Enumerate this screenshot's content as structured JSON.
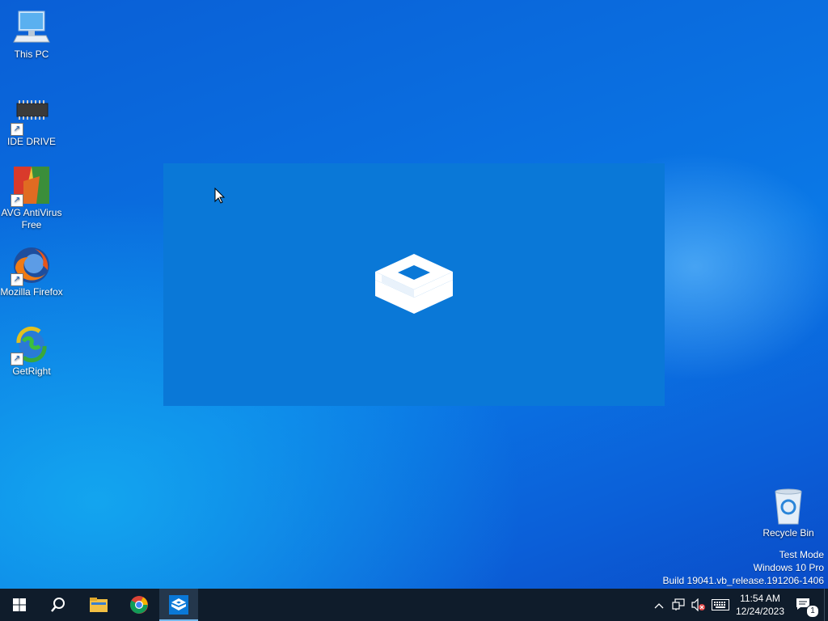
{
  "desktop": {
    "icons": [
      {
        "label": "This PC"
      },
      {
        "label": "IDE DRIVE"
      },
      {
        "label": "AVG AntiVirus Free"
      },
      {
        "label": "Mozilla Firefox"
      },
      {
        "label": "GetRight"
      }
    ],
    "recycle_bin": {
      "label": "Recycle Bin"
    }
  },
  "watermark": {
    "line1": "Test Mode",
    "line2": "Windows 10 Pro",
    "line3": "Build 19041.vb_release.191206-1406"
  },
  "taskbar": {
    "pinned": [
      "start-icon",
      "search-icon",
      "file-explorer-icon",
      "chrome-icon",
      "sandbox-icon"
    ],
    "clock": {
      "time": "11:54 AM",
      "date": "12/24/2023"
    },
    "notifications_count": "1"
  },
  "colors": {
    "splash": "#0a78d7",
    "taskbar": "#0f1c2b",
    "accent": "#76b9ed"
  }
}
